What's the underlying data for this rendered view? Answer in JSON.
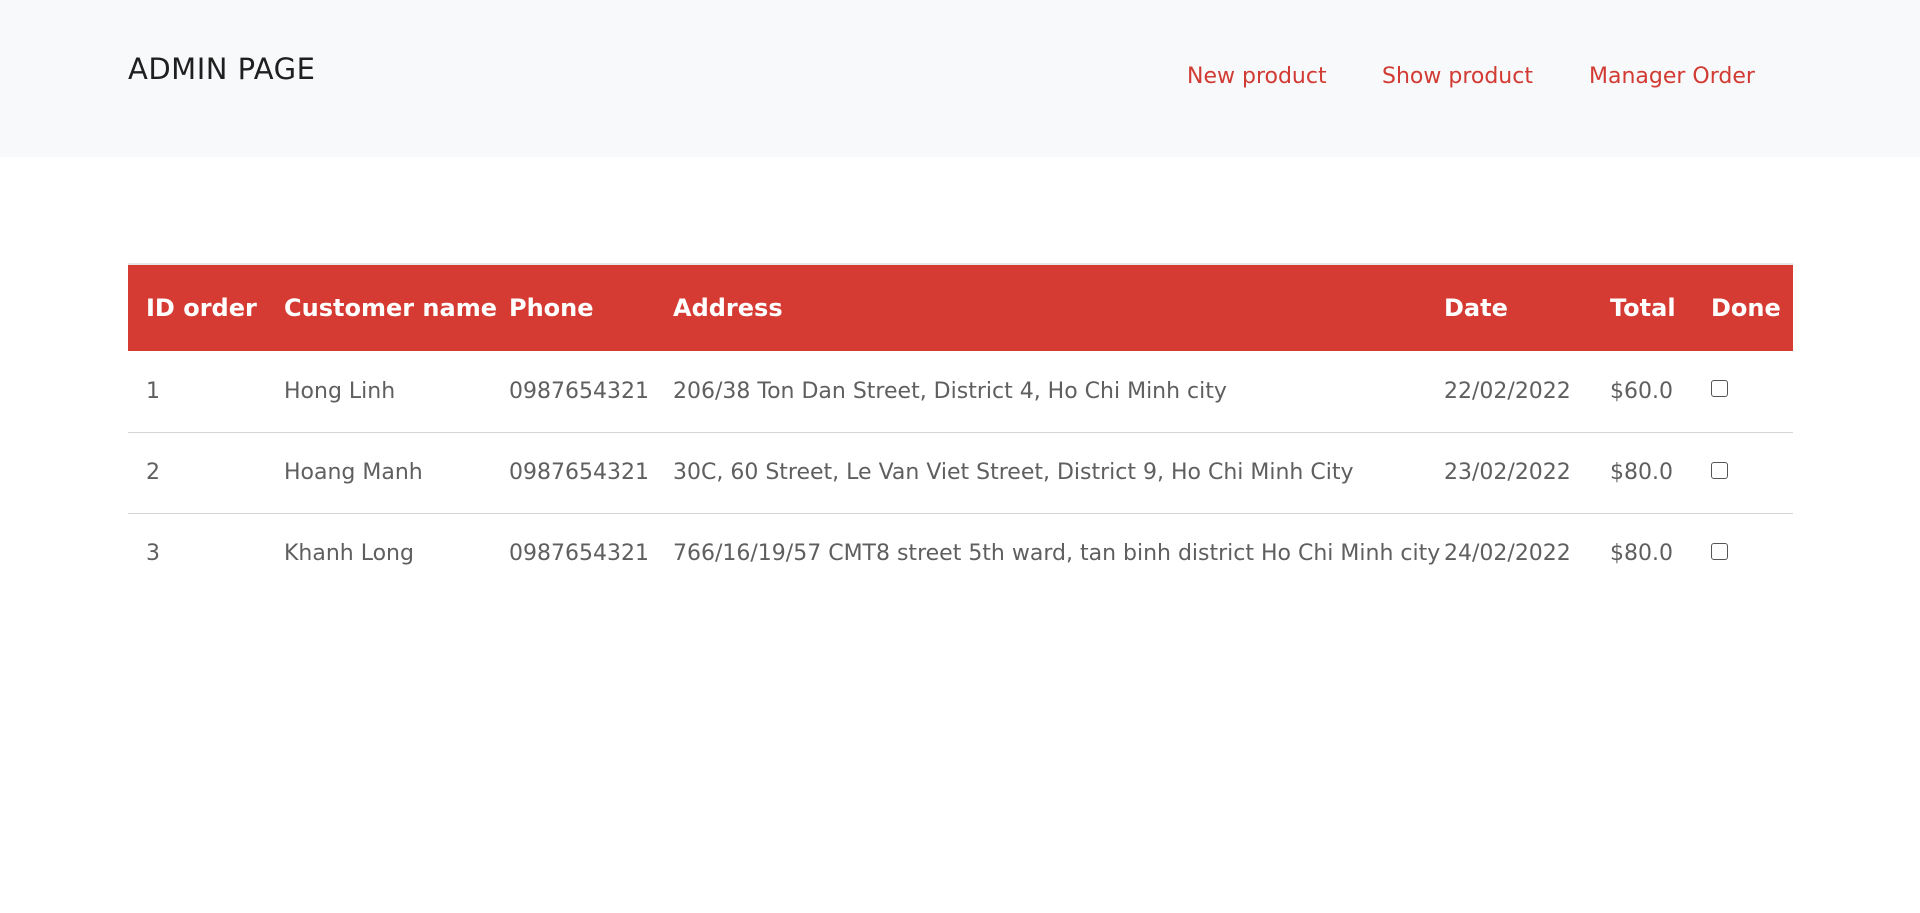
{
  "header": {
    "brand": "ADMIN PAGE",
    "nav": [
      {
        "label": "New product"
      },
      {
        "label": "Show product"
      },
      {
        "label": "Manager Order"
      }
    ]
  },
  "colors": {
    "accent": "#d53b33",
    "nav_link": "#d13b33",
    "header_bg": "#f8f9fa"
  },
  "table": {
    "columns": [
      "ID order",
      "Customer name",
      "Phone",
      "Address",
      "Date",
      "Total",
      "Done"
    ],
    "rows": [
      {
        "id": "1",
        "name": "Hong Linh",
        "phone": "0987654321",
        "address": "206/38 Ton Dan Street, District 4, Ho Chi Minh city",
        "date": "22/02/2022",
        "total": "$60.0",
        "done": false
      },
      {
        "id": "2",
        "name": "Hoang Manh",
        "phone": "0987654321",
        "address": "30C, 60 Street, Le Van Viet Street, District 9, Ho Chi Minh City",
        "date": "23/02/2022",
        "total": "$80.0",
        "done": false
      },
      {
        "id": "3",
        "name": "Khanh Long",
        "phone": "0987654321",
        "address": "766/16/19/57 CMT8 street 5th ward, tan binh district Ho Chi Minh city",
        "date": "24/02/2022",
        "total": "$80.0",
        "done": false
      }
    ]
  }
}
